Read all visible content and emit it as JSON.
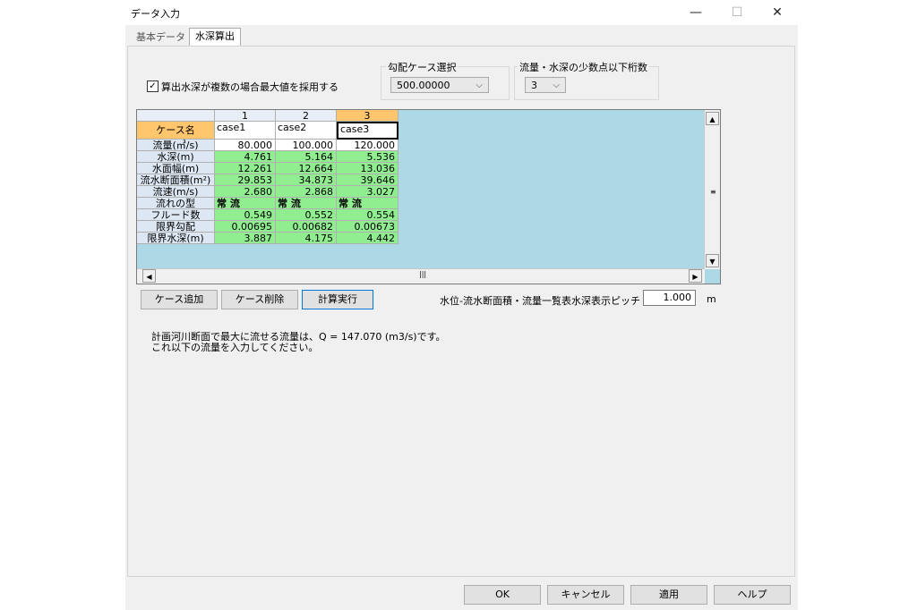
{
  "window": {
    "title": "データ入力",
    "minimize": "—",
    "maximize": "☐",
    "close": "✕"
  },
  "tabs": [
    {
      "label": "基本データ"
    },
    {
      "label": "水深算出"
    }
  ],
  "options": {
    "checkbox_label": "算出水深が複数の場合最大値を採用する",
    "checkbox_checked": "✓",
    "slope_group_label": "勾配ケース選択",
    "slope_value": "500.00000",
    "decimals_group_label": "流量・水深の少数点以下桁数",
    "decimals_value": "3"
  },
  "grid": {
    "columns": [
      "1",
      "2",
      "3"
    ],
    "case_label": "ケース名",
    "cases": [
      "case1",
      "case2",
      "case3"
    ],
    "rows": [
      {
        "label": "流量(㎥/s)",
        "values": [
          "80.000",
          "100.000",
          "120.000"
        ]
      },
      {
        "label": "水深(m)",
        "values": [
          "4.761",
          "5.164",
          "5.536"
        ]
      },
      {
        "label": "水面幅(m)",
        "values": [
          "12.261",
          "12.664",
          "13.036"
        ]
      },
      {
        "label": "流水断面積(m²)",
        "values": [
          "29.853",
          "34.873",
          "39.646"
        ]
      },
      {
        "label": "流速(m/s)",
        "values": [
          "2.680",
          "2.868",
          "3.027"
        ]
      },
      {
        "label": "流れの型",
        "values": [
          "常 流",
          "常 流",
          "常 流"
        ]
      },
      {
        "label": "フルード数",
        "values": [
          "0.549",
          "0.552",
          "0.554"
        ]
      },
      {
        "label": "限界勾配",
        "values": [
          "0.00695",
          "0.00682",
          "0.00673"
        ]
      },
      {
        "label": "限界水深(m)",
        "values": [
          "3.887",
          "4.175",
          "4.442"
        ]
      }
    ]
  },
  "actions": {
    "add_case": "ケース追加",
    "delete_case": "ケース削除",
    "calculate": "計算実行"
  },
  "pitch": {
    "label": "水位-流水断面積・流量一覧表水深表示ピッチ",
    "value": "1.000",
    "unit": "m"
  },
  "message": {
    "line1": "計画河川断面で最大に流せる流量は、Q = 147.070 (m3/s)です。",
    "line2": "これ以下の流量を入力してください。"
  },
  "footer": {
    "ok": "OK",
    "cancel": "キャンセル",
    "apply": "適用",
    "help": "ヘルプ"
  },
  "colors": {
    "highlight_header": "#ffc66e",
    "computed_cell": "#90ee90",
    "grid_background": "#add8e6"
  }
}
